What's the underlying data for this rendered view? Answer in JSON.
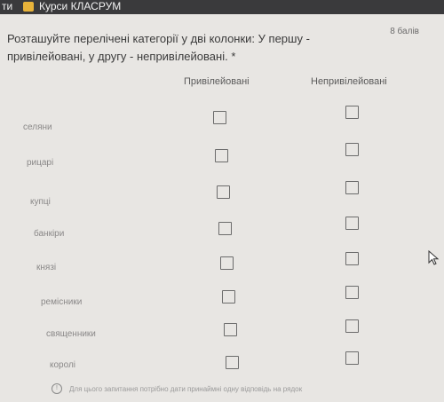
{
  "browser": {
    "left_text": "ти",
    "tab_label": "Курси КЛАСРУМ"
  },
  "question": {
    "text": "Розташуйте перелічені категорії у дві колонки: У першу - привілейовані, у другу - непривілейовані. *",
    "points": "8 балів"
  },
  "columns": [
    "Привілейовані",
    "Непривілейовані"
  ],
  "rows": [
    "селяни",
    "рицарі",
    "купці",
    "банкіри",
    "князі",
    "ремісники",
    "священники",
    "королі"
  ],
  "footer": {
    "note": "Для цього запитання потрібно дати принаймні одну відповідь на рядок"
  },
  "icons": {
    "tab_icon": "classroom-icon",
    "footer_icon": "info-icon",
    "cursor": "mouse-pointer-icon"
  }
}
